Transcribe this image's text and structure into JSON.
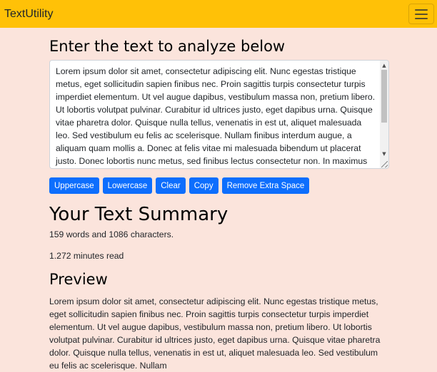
{
  "navbar": {
    "brand": "TextUtility",
    "menu_icon": "hamburger-menu-icon",
    "background": "#ffc107"
  },
  "form": {
    "heading": "Enter the text to analyze below",
    "textarea_value": "Lorem ipsum dolor sit amet, consectetur adipiscing elit. Nunc egestas tristique metus, eget sollicitudin sapien finibus nec. Proin sagittis turpis consectetur turpis imperdiet elementum. Ut vel augue dapibus, vestibulum massa non, pretium libero. Ut lobortis volutpat pulvinar. Curabitur id ultrices justo, eget dapibus urna. Quisque vitae pharetra dolor. Quisque nulla tellus, venenatis in est ut, aliquet malesuada leo. Sed vestibulum eu felis ac scelerisque. Nullam finibus interdum augue, a aliquam quam mollis a. Donec at felis vitae mi malesuada bibendum ut placerat justo. Donec lobortis nunc metus, sed finibus lectus consectetur non. In maximus scelerisque dui, sed euismod eros pulvinar"
  },
  "buttons": {
    "uppercase": "Uppercase",
    "lowercase": "Lowercase",
    "clear": "Clear",
    "copy": "Copy",
    "remove_extra_space": "Remove Extra Space",
    "color": "#0d6efd"
  },
  "summary": {
    "title": "Your Text Summary",
    "counts": "159 words and 1086 characters.",
    "read_time": "1.272 minutes read"
  },
  "preview": {
    "title": "Preview",
    "text": "Lorem ipsum dolor sit amet, consectetur adipiscing elit. Nunc egestas tristique metus, eget sollicitudin sapien finibus nec. Proin sagittis turpis consectetur turpis imperdiet elementum. Ut vel augue dapibus, vestibulum massa non, pretium libero. Ut lobortis volutpat pulvinar. Curabitur id ultrices justo, eget dapibus urna. Quisque vitae pharetra dolor. Quisque nulla tellus, venenatis in est ut, aliquet malesuada leo. Sed vestibulum eu felis ac scelerisque. Nullam"
  },
  "page": {
    "background": "#fbe4dc"
  }
}
